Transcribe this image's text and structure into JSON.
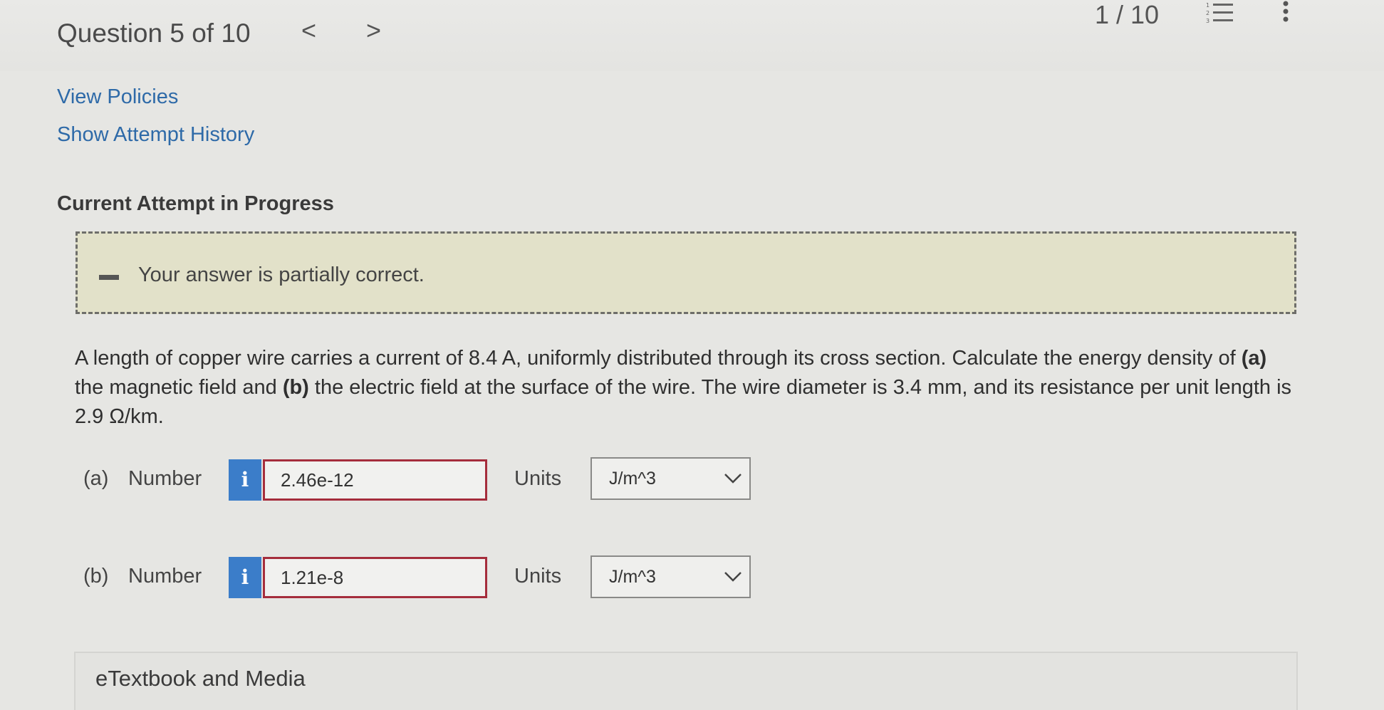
{
  "header": {
    "question_label": "Question 5 of 10",
    "prev_glyph": "<",
    "next_glyph": ">",
    "page_count": "1 / 10",
    "list_icon": "list-icon",
    "more_icon": "more-vertical-icon"
  },
  "links": {
    "view_policies": "View Policies",
    "show_attempt_history": "Show Attempt History"
  },
  "attempt": {
    "title": "Current Attempt in Progress"
  },
  "feedback": {
    "icon": "minus-icon",
    "text": "Your answer is partially correct."
  },
  "question": {
    "text_1": "A length of copper wire carries a current of 8.4 A, uniformly distributed through its cross section. Calculate the energy density of ",
    "part_a_tag": "(a)",
    "text_2": " the magnetic field and ",
    "part_b_tag": "(b)",
    "text_3": " the electric field at the surface of the wire. The wire diameter is 3.4 mm, and its resistance per unit length is 2.9 Ω/km."
  },
  "answers": [
    {
      "part_label": "(a)",
      "number_label": "Number",
      "info_glyph": "i",
      "value": "2.46e-12",
      "units_label": "Units",
      "units_value": "J/m^3"
    },
    {
      "part_label": "(b)",
      "number_label": "Number",
      "info_glyph": "i",
      "value": "1.21e-8",
      "units_label": "Units",
      "units_value": "J/m^3"
    }
  ],
  "etextbook": {
    "label": "eTextbook and Media"
  },
  "colors": {
    "link": "#2e6aa8",
    "info_button": "#3b7dc9",
    "incorrect_border": "#a52d3c",
    "feedback_bg": "#e2e1c9"
  }
}
